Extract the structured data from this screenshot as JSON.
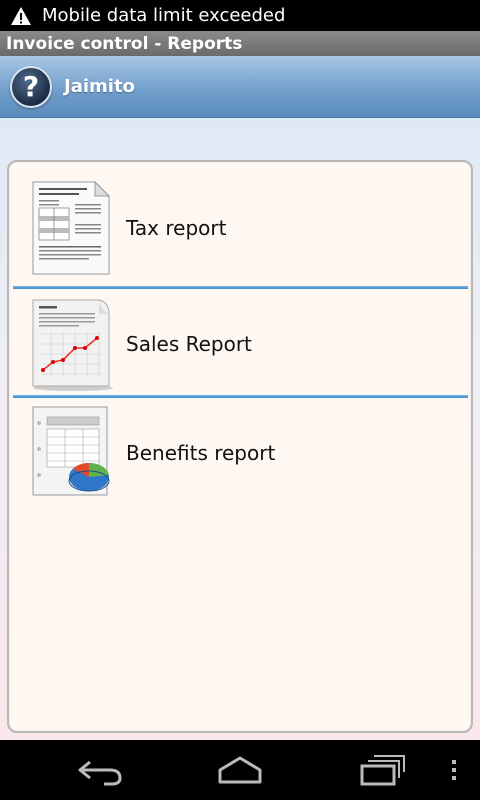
{
  "status_bar": {
    "notification": "Mobile data limit exceeded"
  },
  "title_bar": {
    "title": "Invoice control - Reports"
  },
  "header": {
    "user_name": "Jaimito",
    "help_icon": "?"
  },
  "reports": [
    {
      "label": "Tax report",
      "icon": "tax-document-icon"
    },
    {
      "label": "Sales Report",
      "icon": "sales-chart-icon"
    },
    {
      "label": "Benefits report",
      "icon": "benefits-pie-icon"
    }
  ],
  "nav": {
    "back": "back-icon",
    "home": "home-icon",
    "recents": "recents-icon",
    "menu": "menu-icon"
  },
  "colors": {
    "header_blue": "#6e9cc9",
    "divider_blue": "#3a8ad0",
    "panel_bg": "#fff7f2"
  }
}
